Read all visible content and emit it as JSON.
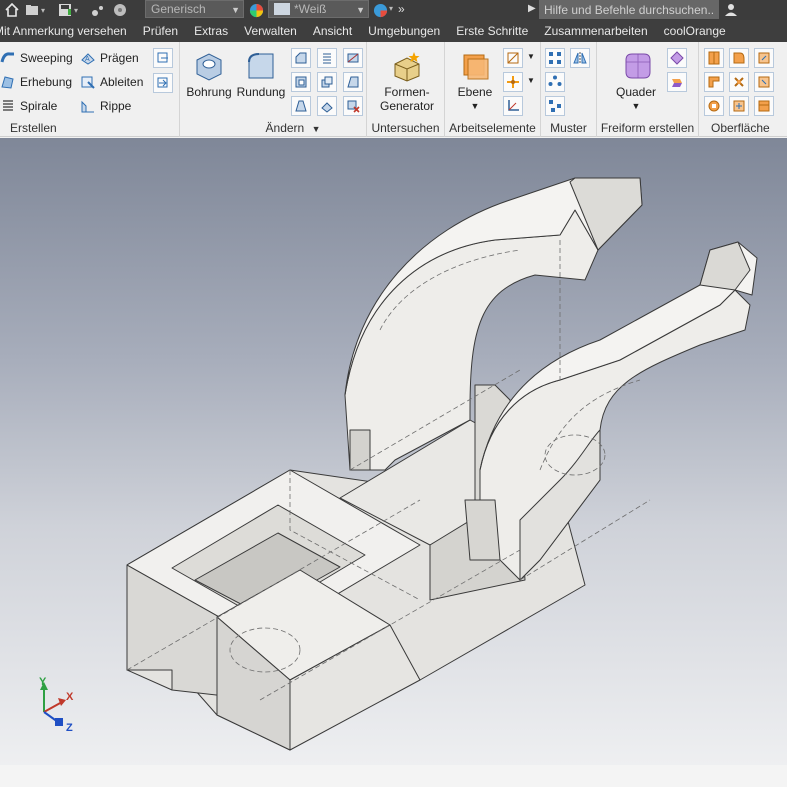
{
  "quick_access": {
    "icons": [
      "home-icon",
      "open-icon",
      "save-icon",
      "measure-icon",
      "material-icon"
    ],
    "material_combo": "Generisch",
    "appearance_combo": "*Weiß",
    "search_placeholder": "Hilfe und Befehle durchsuchen..",
    "more_glyph": "»"
  },
  "tabs": [
    "Mit Anmerkung versehen",
    "Prüfen",
    "Extras",
    "Verwalten",
    "Ansicht",
    "Umgebungen",
    "Erste Schritte",
    "Zusammenarbeiten",
    "coolOrange"
  ],
  "ribbon": {
    "erstellen": {
      "title": "Erstellen",
      "items": [
        "Sweeping",
        "Erhebung",
        "Spirale",
        "Prägen",
        "Ableiten",
        "Rippe"
      ]
    },
    "aendern": {
      "title": "Ändern",
      "big_buttons": [
        "Bohrung",
        "Rundung"
      ]
    },
    "untersuchen": {
      "title": "Untersuchen",
      "button_line1": "Formen-",
      "button_line2": "Generator"
    },
    "arbeitselemente": {
      "title": "Arbeitselemente",
      "button": "Ebene"
    },
    "muster": {
      "title": "Muster"
    },
    "freiform": {
      "title": "Freiform erstellen",
      "button": "Quader"
    },
    "oberflaeche": {
      "title": "Oberfläche"
    }
  },
  "view_axes": {
    "x": "X",
    "y": "Y",
    "z": "Z"
  },
  "colors": {
    "titlebar": "#3c3c3c",
    "tabbar": "#3e3e3e",
    "ribbon": "#f0f0f0",
    "part_fill": "#ececea",
    "part_edge": "#3a3a3a",
    "hidden_edge": "#6d6d6d"
  }
}
